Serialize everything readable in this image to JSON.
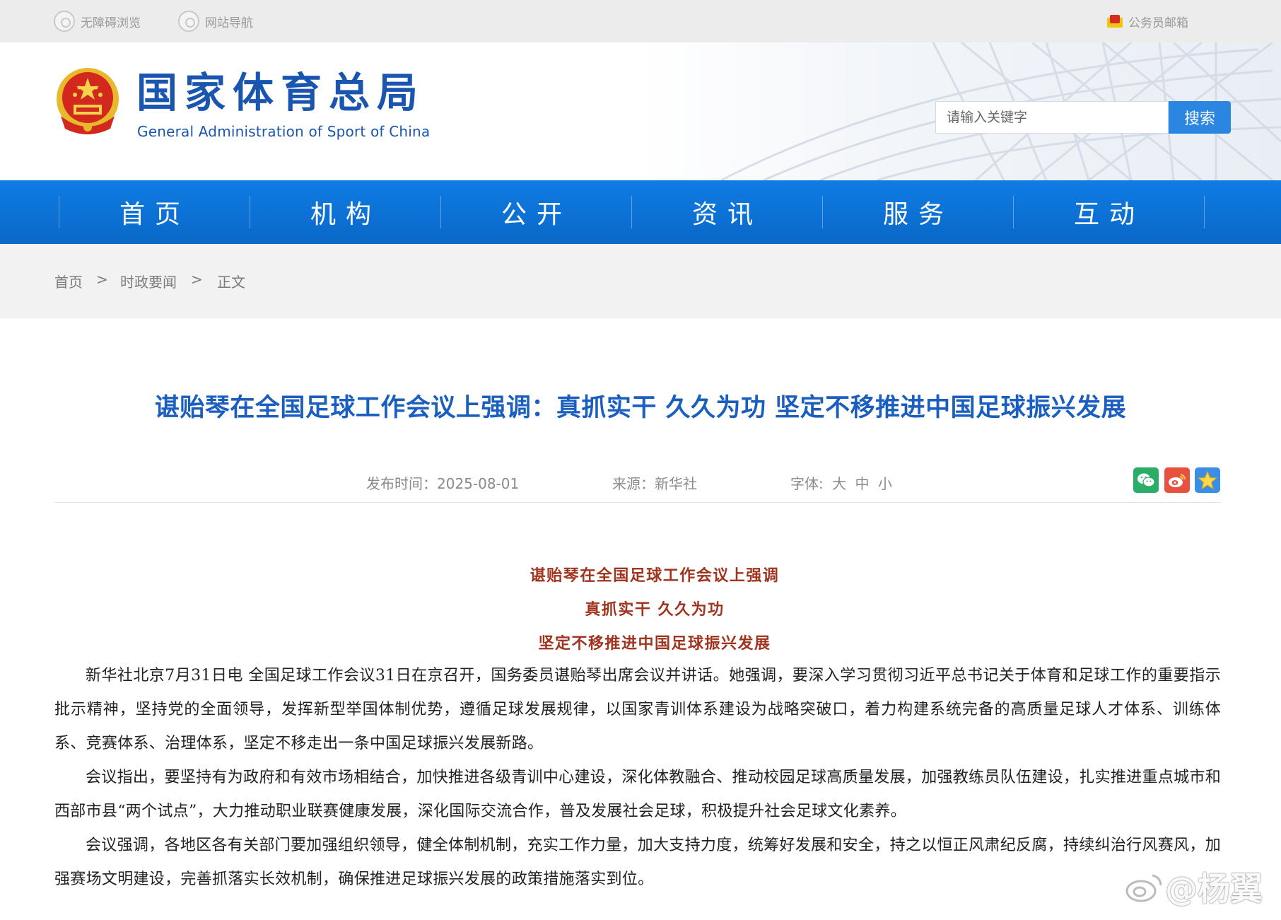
{
  "topbar": {
    "accessibility": "无障碍浏览",
    "site_nav": "网站导航",
    "staff_mail": "公务员邮箱"
  },
  "header": {
    "title": "国家体育总局",
    "subtitle": "General Administration of Sport of China",
    "search_placeholder": "请输入关键字",
    "search_button": "搜索"
  },
  "nav": {
    "tabs": [
      "首页",
      "机构",
      "公开",
      "资讯",
      "服务",
      "互动"
    ]
  },
  "breadcrumb": {
    "home": "首页",
    "section": "时政要闻",
    "current": "正文",
    "sep": ">"
  },
  "article": {
    "title": "谌贻琴在全国足球工作会议上强调：真抓实干 久久为功 坚定不移推进中国足球振兴发展",
    "publish_time": "发布时间：2025-08-01",
    "source": "来源：新华社",
    "font_label": "字体:",
    "font_large": "大",
    "font_medium": "中",
    "font_small": "小",
    "subheads": [
      "谌贻琴在全国足球工作会议上强调",
      "真抓实干  久久为功",
      "坚定不移推进中国足球振兴发展"
    ],
    "paragraphs": [
      "新华社北京7月31日电  全国足球工作会议31日在京召开，国务委员谌贻琴出席会议并讲话。她强调，要深入学习贯彻习近平总书记关于体育和足球工作的重要指示批示精神，坚持党的全面领导，发挥新型举国体制优势，遵循足球发展规律，以国家青训体系建设为战略突破口，着力构建系统完备的高质量足球人才体系、训练体系、竞赛体系、治理体系，坚定不移走出一条中国足球振兴发展新路。",
      "会议指出，要坚持有为政府和有效市场相结合，加快推进各级青训中心建设，深化体教融合、推动校园足球高质量发展，加强教练员队伍建设，扎实推进重点城市和西部市县“两个试点”，大力推动职业联赛健康发展，深化国际交流合作，普及发展社会足球，积极提升社会足球文化素养。",
      "会议强调，各地区各有关部门要加强组织领导，健全体制机制，充实工作力量，加大支持力度，统筹好发展和安全，持之以恒正风肃纪反腐，持续纠治行风赛风，加强赛场文明建设，完善抓落实长效机制，确保推进足球振兴发展的政策措施落实到位。"
    ]
  },
  "watermark": {
    "text": "@杨翼"
  },
  "colors": {
    "nav_blue": "#0a6fd6",
    "title_blue": "#1a5fbf",
    "subhead_red": "#a0341f",
    "wechat_green": "#2aae67",
    "weibo_red": "#e8513f",
    "fav_blue": "#3a8ee6"
  }
}
